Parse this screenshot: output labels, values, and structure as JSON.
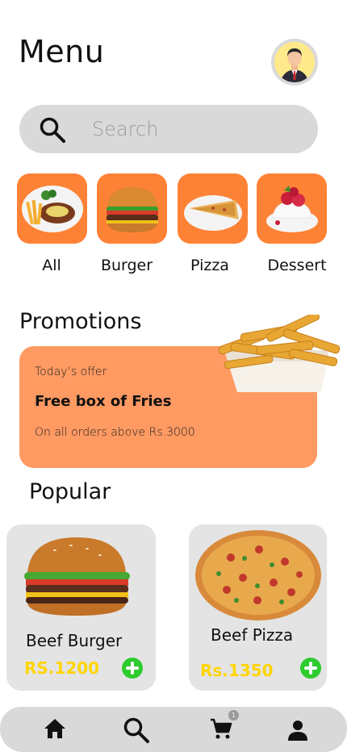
{
  "header": {
    "title": "Menu"
  },
  "search": {
    "placeholder": "Search"
  },
  "categories": [
    {
      "label": "All",
      "icon": "steak-plate-icon"
    },
    {
      "label": "Burger",
      "icon": "burger-icon"
    },
    {
      "label": "Pizza",
      "icon": "pizza-slice-icon"
    },
    {
      "label": "Dessert",
      "icon": "dessert-icon"
    }
  ],
  "promotions": {
    "title": "Promotions",
    "subtitle": "Today’s offer",
    "headline": "Free box of Fries",
    "note": "On all orders above Rs.3000"
  },
  "popular": {
    "title": "Popular",
    "items": [
      {
        "name": "Beef Burger",
        "price": "RS.1200"
      },
      {
        "name": "Beef Pizza",
        "price": "Rs.1350"
      }
    ]
  },
  "nav": {
    "items": [
      "home-icon",
      "search-icon",
      "cart-icon",
      "profile-icon"
    ],
    "cart_badge": "1"
  },
  "colors": {
    "accent": "#fe8235",
    "promo": "#fe9a62",
    "price": "#ffd500",
    "add": "#2ecc2e",
    "surface": "#d9d9d9"
  }
}
